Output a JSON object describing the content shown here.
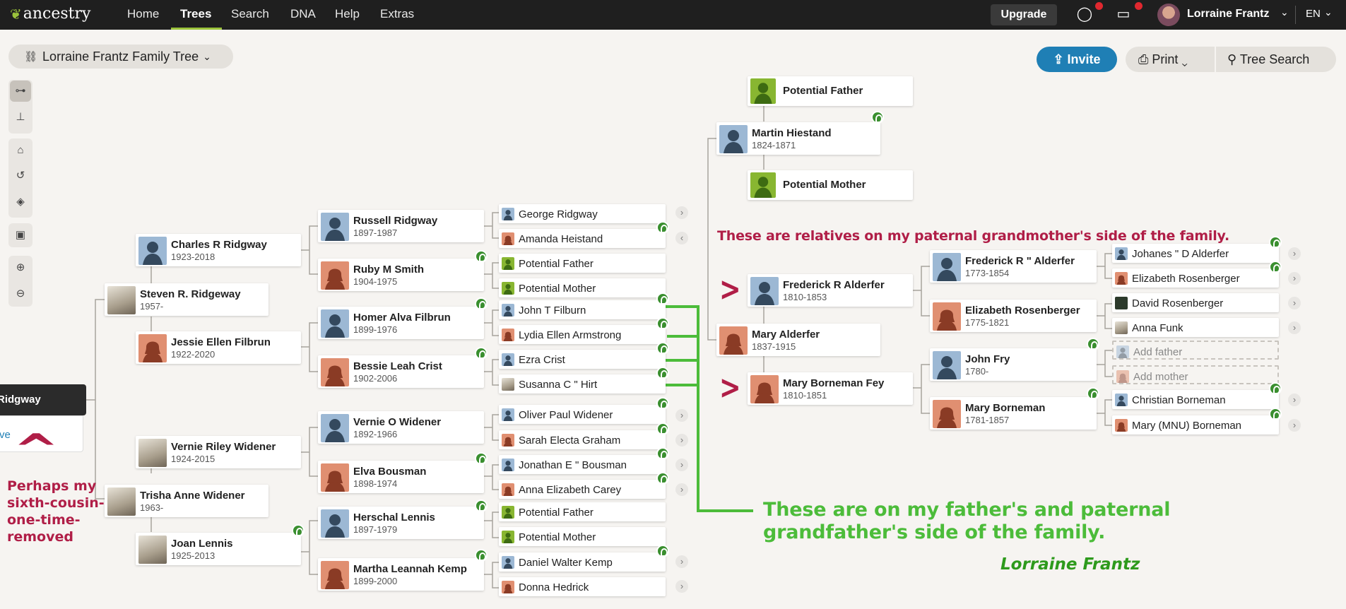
{
  "nav": {
    "logo": "ancestry",
    "links": [
      "Home",
      "Trees",
      "Search",
      "DNA",
      "Help",
      "Extras"
    ],
    "active_link": "Trees",
    "upgrade": "Upgrade",
    "user": "Lorraine Frantz",
    "lang": "EN"
  },
  "toolbar": {
    "tree_name": "Lorraine Frantz Family Tree",
    "invite": "Invite",
    "print": "Print",
    "tree_search": "Tree Search"
  },
  "tree": {
    "home_person": "Ridgway",
    "home_person_link": "ve",
    "gen1": [
      {
        "name": "Steven R. Ridgeway",
        "dates": "1957-"
      },
      {
        "name": "Trisha Anne Widener",
        "dates": "1963-"
      }
    ],
    "gen2": [
      {
        "name": "Charles R Ridgway",
        "dates": "1923-2018"
      },
      {
        "name": "Jessie Ellen Filbrun",
        "dates": "1922-2020"
      },
      {
        "name": "Vernie Riley Widener",
        "dates": "1924-2015"
      },
      {
        "name": "Joan Lennis",
        "dates": "1925-2013"
      }
    ],
    "gen3": [
      {
        "name": "Russell Ridgway",
        "dates": "1897-1987"
      },
      {
        "name": "Ruby M Smith",
        "dates": "1904-1975"
      },
      {
        "name": "Homer Alva Filbrun",
        "dates": "1899-1976"
      },
      {
        "name": "Bessie Leah Crist",
        "dates": "1902-2006"
      },
      {
        "name": "Vernie O Widener",
        "dates": "1892-1966"
      },
      {
        "name": "Elva Bousman",
        "dates": "1898-1974"
      },
      {
        "name": "Herschal Lennis",
        "dates": "1897-1979"
      },
      {
        "name": "Martha Leannah Kemp",
        "dates": "1899-2000"
      }
    ],
    "gen4": [
      "George Ridgway",
      "Amanda Heistand",
      "Potential Father",
      "Potential Mother",
      "John T Filburn",
      "Lydia Ellen Armstrong",
      "Ezra Crist",
      "Susanna C \" Hirt",
      "Oliver Paul Widener",
      "Sarah Electa Graham",
      "Jonathan E \" Bousman",
      "Anna Elizabeth Carey",
      "Potential Father",
      "Potential Mother",
      "Daniel Walter Kemp",
      "Donna Hedrick"
    ],
    "heistand_branch": {
      "potential_father": "Potential Father",
      "martin": {
        "name": "Martin Hiestand",
        "dates": "1824-1871"
      },
      "potential_mother": "Potential Mother"
    },
    "alderfer_branch": {
      "frederick": {
        "name": "Frederick R Alderfer",
        "dates": "1810-1853"
      },
      "mary": {
        "name": "Mary Alderfer",
        "dates": "1837-1915"
      },
      "mary_fey": {
        "name": "Mary Borneman Fey",
        "dates": "1810-1851"
      }
    },
    "right_gen": [
      {
        "name": "Frederick R \" Alderfer",
        "dates": "1773-1854"
      },
      {
        "name": "Elizabeth Rosenberger",
        "dates": "1775-1821"
      },
      {
        "name": "John Fry",
        "dates": "1780-"
      },
      {
        "name": "Mary Borneman",
        "dates": "1781-1857"
      }
    ],
    "right_gen2": [
      "Johanes \" D Alderfer",
      "Elizabeth Rosenberger",
      "David Rosenberger",
      "Anna Funk",
      "Add father",
      "Add mother",
      "Christian Borneman",
      "Mary (MNU) Borneman"
    ]
  },
  "annotations": {
    "maternal": "These are relatives on my paternal grandmother's side of the family.",
    "paternal_line1": "These are on my father's and paternal",
    "paternal_line2": "grandfather's side of the family.",
    "signature": "Lorraine Frantz",
    "cousin_lines": [
      "Perhaps my",
      "sixth-cousin-",
      "one-time-",
      "removed"
    ]
  },
  "colors": {
    "male": "#9cb8d4",
    "female": "#e08f71",
    "unknown": "#88b631",
    "hint": "#3a8f2f",
    "accent_nav": "#9bc33b",
    "annotation_red": "#b01e47",
    "annotation_green": "#4cbc3a"
  }
}
